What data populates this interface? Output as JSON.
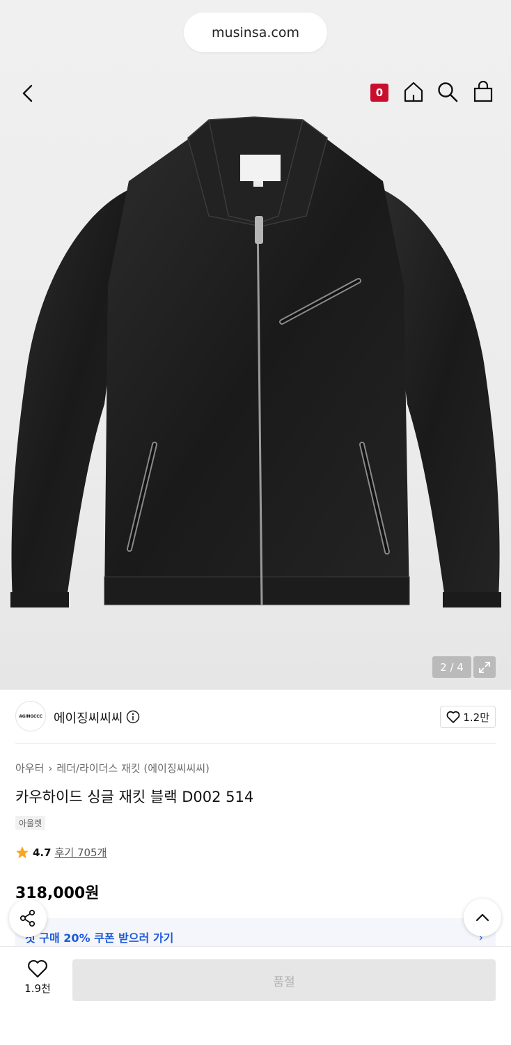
{
  "browser": {
    "url": "musinsa.com"
  },
  "header": {
    "back_icon": "chevron-left-icon",
    "cart_badge_count": "0",
    "home_icon": "home-icon",
    "search_icon": "search-icon",
    "bag_icon": "shopping-bag-icon"
  },
  "gallery": {
    "counter": "2 / 4",
    "expand_icon": "expand-icon"
  },
  "brand": {
    "logo_text": "AGINGCCC",
    "name": "에이징씨씨씨",
    "info_icon": "info-icon",
    "likes": "1.2만"
  },
  "product": {
    "breadcrumb": [
      "아우터",
      "레더/라이더스 재킷 (에이징씨씨씨)"
    ],
    "title": "카우하이드 싱글 재킷 블랙 D002 514",
    "tag": "아울렛",
    "rating": "4.7",
    "review_link": "후기 705개",
    "price": "318,000원"
  },
  "coupon": {
    "text": "첫 구매 20% 쿠폰 받으러 가기",
    "arrow": "›"
  },
  "floating": {
    "share_icon": "share-icon",
    "scroll_top_icon": "chevron-up-icon"
  },
  "bottom_bar": {
    "wish_count": "1.9천",
    "buy_label": "품절"
  },
  "colors": {
    "badge": "#c8102e",
    "coupon_text": "#1d5ad8",
    "star": "#f5a623"
  }
}
